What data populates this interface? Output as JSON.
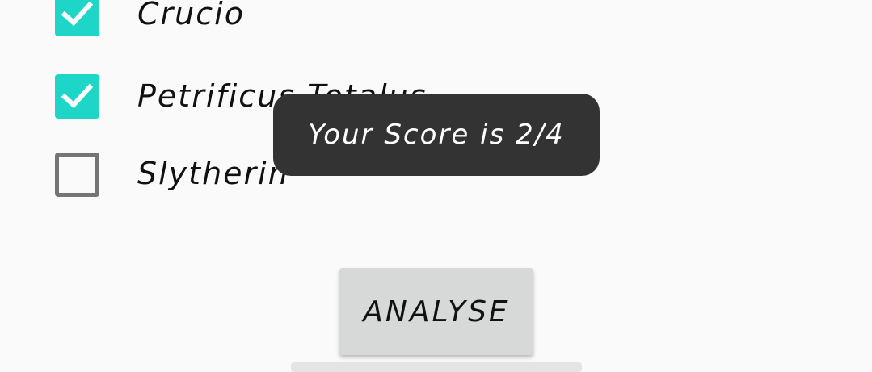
{
  "options": [
    {
      "label": "Crucio",
      "checked": true
    },
    {
      "label": "Petrificus Totalus",
      "checked": true
    },
    {
      "label": "Slytherin",
      "checked": false
    }
  ],
  "toast": {
    "text": "Your Score is 2/4"
  },
  "analyse_button": {
    "label": "ANALYSE"
  },
  "colors": {
    "checkbox_checked": "#1ed6c8",
    "checkbox_unchecked_border": "#757575",
    "toast_bg": "#333333",
    "button_bg": "#d7d8d8"
  },
  "icons": {
    "check": "check-icon"
  }
}
